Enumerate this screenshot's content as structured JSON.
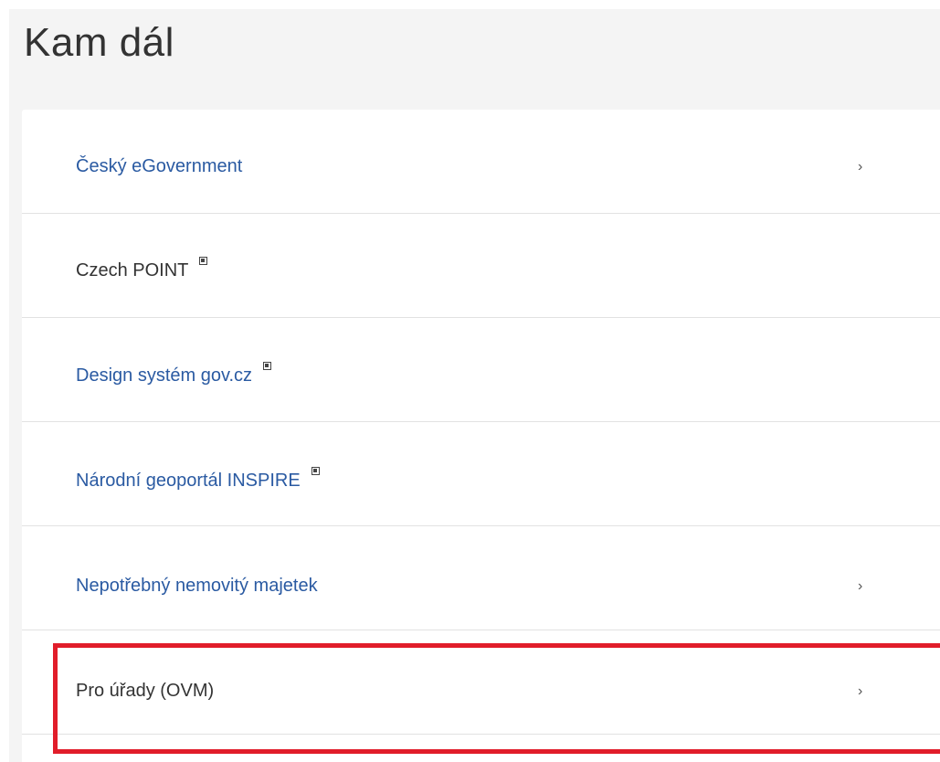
{
  "section": {
    "title": "Kam dál"
  },
  "links": [
    {
      "label": "Český eGovernment",
      "style": "blue",
      "external": false,
      "chevron": true,
      "icon": "chevron-right-icon"
    },
    {
      "label": "Czech POINT",
      "style": "dark",
      "external": true,
      "chevron": false,
      "icon": "external-link-icon"
    },
    {
      "label": "Design systém gov.cz",
      "style": "blue",
      "external": true,
      "chevron": false,
      "icon": "external-link-icon"
    },
    {
      "label": "Národní geoportál INSPIRE",
      "style": "blue",
      "external": true,
      "chevron": false,
      "icon": "external-link-icon"
    },
    {
      "label": "Nepotřebný nemovitý majetek",
      "style": "blue",
      "external": false,
      "chevron": true,
      "icon": "chevron-right-icon"
    },
    {
      "label": "Pro úřady (OVM)",
      "style": "dark",
      "external": false,
      "chevron": true,
      "icon": "chevron-right-icon"
    }
  ],
  "chevron_glyph": "›",
  "colors": {
    "link_blue": "#2a5aa2",
    "text_dark": "#333333",
    "highlight_red": "#e11d2a",
    "page_bg": "#f4f4f4"
  }
}
